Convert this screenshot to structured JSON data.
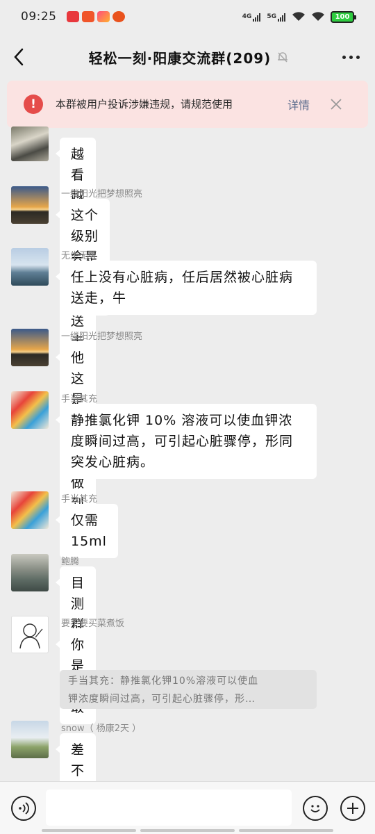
{
  "status_bar": {
    "time": "09:25",
    "network_1": "4G",
    "network_2": "5G",
    "battery": "100"
  },
  "header": {
    "title": "轻松一刻·阳康交流群(209)",
    "back_icon": "chevron-left-icon",
    "mute_icon": "bell-muted-icon",
    "more_icon": "more-dots-icon"
  },
  "banner": {
    "icon_glyph": "!",
    "text": "本群被用户投诉涉嫌违规，请规范使用",
    "detail_label": "详情",
    "accent": "#e54c4a",
    "background": "#fbe3e2"
  },
  "messages": [
    {
      "sender": "",
      "text": "越看越觉得他是被送走的"
    },
    {
      "sender": "一缕阳光把梦想照亮",
      "text": "这个级别会是心脏病？"
    },
    {
      "sender": "无生无灭",
      "text": "任上没有心脏病，任后居然被心脏病送走，牛"
    },
    {
      "sender": "一缕阳光把梦想照亮",
      "text": "他这是要坏人做到底"
    },
    {
      "sender": "手当其充",
      "text": "静推氯化钾 10% 溶液可以使血钾浓度瞬间过高，可引起心脏骤停，形同突发心脏病。"
    },
    {
      "sender": "手当其充",
      "text": "仅需 15ml"
    },
    {
      "sender": "鲍腾",
      "text": "目测群要炸"
    },
    {
      "sender": "要不要买菜煮饭",
      "text": "你是真敢"
    },
    {
      "sender": "snow（ 杨康2天 ）",
      "text": "差不多停了啊"
    }
  ],
  "quote": {
    "text": "手当其充：静推氯化钾10%溶液可以使血钾浓度瞬间过高，可引起心脏骤停，形…",
    "line1": "手当其充：静推氯化钾10%溶液可以使血",
    "line2": "钾浓度瞬间过高，可引起心脏骤停，形…"
  },
  "input_bar": {
    "value": "",
    "voice_icon": "voice-icon",
    "emoji_icon": "smile-icon",
    "plus_icon": "plus-icon"
  }
}
